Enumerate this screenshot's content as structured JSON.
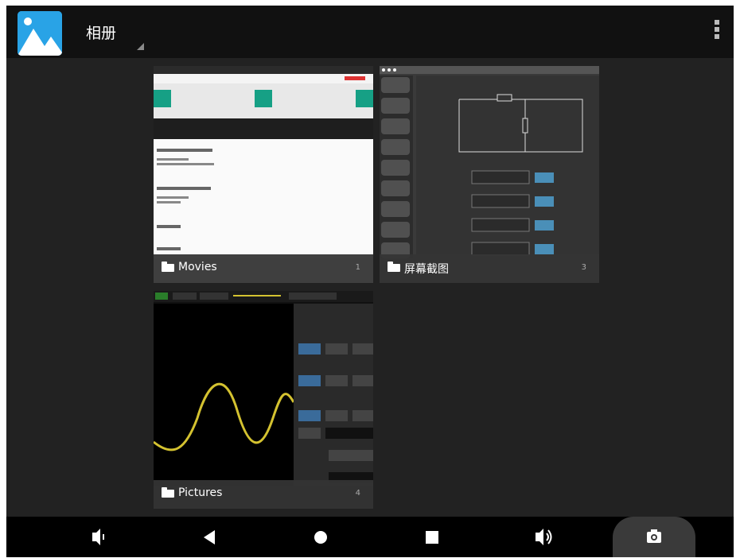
{
  "app": {
    "title": "相册",
    "icon": "gallery-icon"
  },
  "action_bar": {
    "overflow_icon": "more-vert-icon"
  },
  "albums": [
    {
      "name": "Movies",
      "count": "1"
    },
    {
      "name": "屏幕截图",
      "count": "3"
    },
    {
      "name": "Pictures",
      "count": "4"
    }
  ],
  "nav_bar": {
    "buttons": [
      "volume-down-icon",
      "back-icon",
      "home-icon",
      "recents-icon",
      "volume-up-icon",
      "camera-icon"
    ]
  },
  "colors": {
    "background": "#222222",
    "action_bar": "#111111",
    "nav_bar": "#000000",
    "app_icon_blue": "#29a3e6",
    "waveform": "#d4c230",
    "accent_teal": "#16a085"
  }
}
